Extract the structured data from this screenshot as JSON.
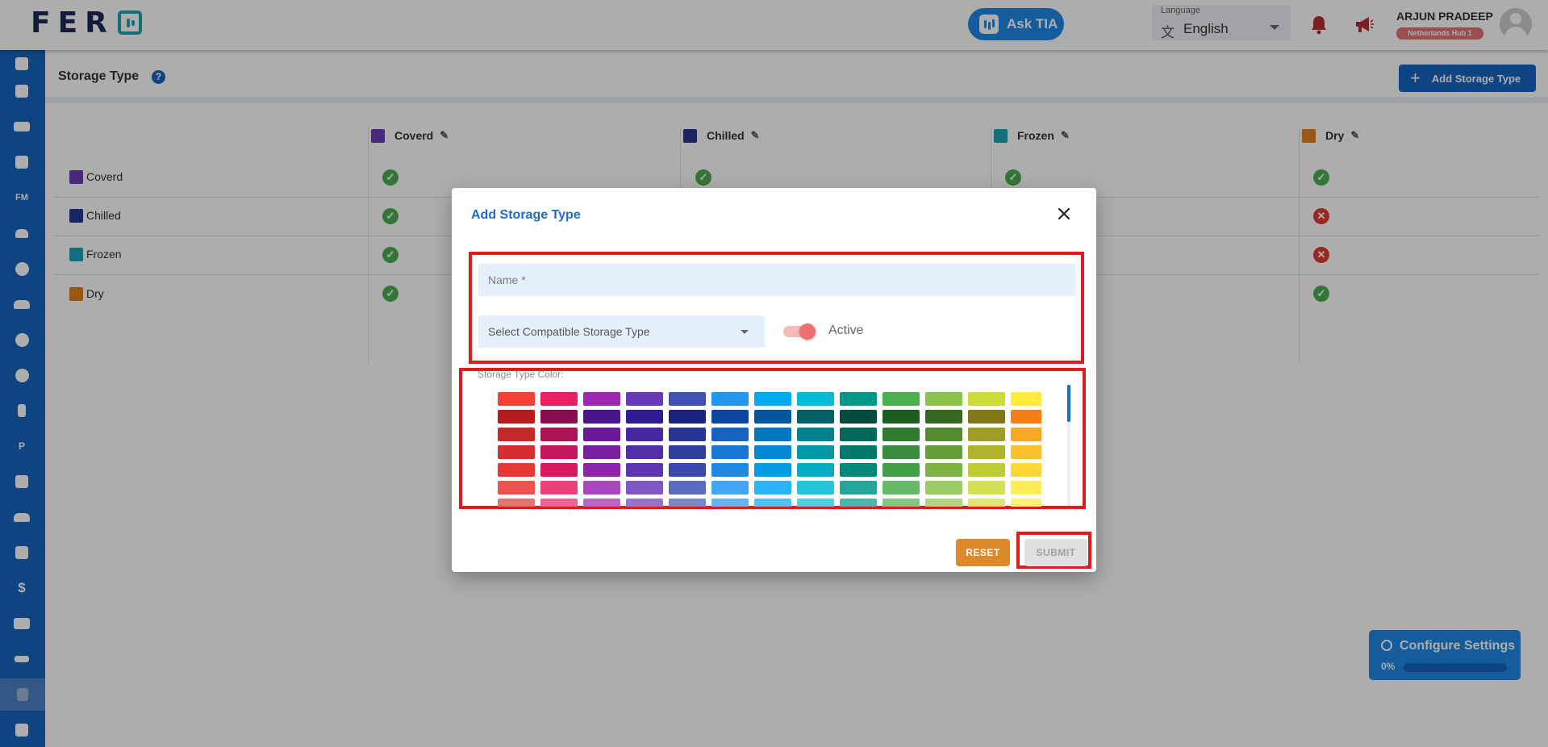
{
  "header": {
    "logo_text": "FER",
    "ask_tia_label": "Ask TIA",
    "language_label": "Language",
    "language_value": "English",
    "user_name": "ARJUN PRADEEP",
    "hub_badge": "Netherlands Hub 1"
  },
  "sidebar": {
    "icons": [
      "chart-icon",
      "calendar-edit-icon",
      "truck-icon",
      "archive-icon",
      "fm-icon",
      "people-icon",
      "alert-icon",
      "group-icon",
      "face-icon",
      "settings-icon",
      "branch-icon",
      "parking-icon",
      "warehouse-icon",
      "team-icon",
      "table-settings-icon",
      "dollar-icon",
      "id-card-icon",
      "key-icon",
      "document-icon",
      "note-edit-icon"
    ],
    "fm_label": "FM",
    "parking_label": "P",
    "dollar_label": "$"
  },
  "page": {
    "title": "Storage Type",
    "help": "?",
    "add_button_label": "Add Storage Type",
    "columns": [
      {
        "label": "Coverd",
        "color": "#6a3fb8"
      },
      {
        "label": "Chilled",
        "color": "#283593"
      },
      {
        "label": "Frozen",
        "color": "#1aa6b7"
      },
      {
        "label": "Dry",
        "color": "#e0801e"
      }
    ],
    "rows": [
      {
        "label": "Coverd",
        "color": "#6a3fb8",
        "values": [
          true,
          true,
          true,
          true
        ]
      },
      {
        "label": "Chilled",
        "color": "#283593",
        "values": [
          true,
          null,
          null,
          false
        ]
      },
      {
        "label": "Frozen",
        "color": "#1aa6b7",
        "values": [
          true,
          null,
          null,
          false
        ]
      },
      {
        "label": "Dry",
        "color": "#e0801e",
        "values": [
          true,
          null,
          null,
          true
        ]
      }
    ],
    "check_glyph": "✓",
    "cross_glyph": "✕"
  },
  "modal": {
    "title": "Add Storage Type",
    "name_placeholder": "Name *",
    "select_placeholder": "Select Compatible Storage Type",
    "active_label": "Active",
    "active_on": true,
    "color_label": "Storage Type Color:",
    "palette": [
      [
        "#f44336",
        "#e91e63",
        "#9c27b0",
        "#673ab7",
        "#3f51b5",
        "#2196f3",
        "#03a9f4",
        "#00bcd4",
        "#009688",
        "#4caf50",
        "#8bc34a",
        "#cddc39",
        "#ffeb3b"
      ],
      [
        "#b71c1c",
        "#880e4f",
        "#4a148c",
        "#311b92",
        "#1a237e",
        "#0d47a1",
        "#01579b",
        "#006064",
        "#004d40",
        "#1b5e20",
        "#33691e",
        "#827717",
        "#f57f17"
      ],
      [
        "#c62828",
        "#ad1457",
        "#6a1b9a",
        "#4527a0",
        "#283593",
        "#1565c0",
        "#0277bd",
        "#00838f",
        "#00695c",
        "#2e7d32",
        "#558b2f",
        "#9e9d24",
        "#f9a825"
      ],
      [
        "#d32f2f",
        "#c2185b",
        "#7b1fa2",
        "#512da8",
        "#303f9f",
        "#1976d2",
        "#0288d1",
        "#0097a7",
        "#00796b",
        "#388e3c",
        "#689f38",
        "#afb42b",
        "#fbc02d"
      ],
      [
        "#e53935",
        "#d81b60",
        "#8e24aa",
        "#5e35b1",
        "#3949ab",
        "#1e88e5",
        "#039be5",
        "#00acc1",
        "#00897b",
        "#43a047",
        "#7cb342",
        "#c0ca33",
        "#fdd835"
      ],
      [
        "#ef5350",
        "#ec407a",
        "#ab47bc",
        "#7e57c2",
        "#5c6bc0",
        "#42a5f5",
        "#29b6f6",
        "#26c6da",
        "#26a69a",
        "#66bb6a",
        "#9ccc65",
        "#d4e157",
        "#ffee58"
      ],
      [
        "#e57373",
        "#f06292",
        "#ba68c8",
        "#9575cd",
        "#7986cb",
        "#64b5f6",
        "#4fc3f7",
        "#4dd0e1",
        "#4db6ac",
        "#81c784",
        "#aed581",
        "#dce775",
        "#fff176"
      ]
    ],
    "reset_label": "RESET",
    "submit_label": "SUBMIT"
  },
  "config_widget": {
    "title": "Configure Settings",
    "percent_label": "0%",
    "progress": 0
  }
}
